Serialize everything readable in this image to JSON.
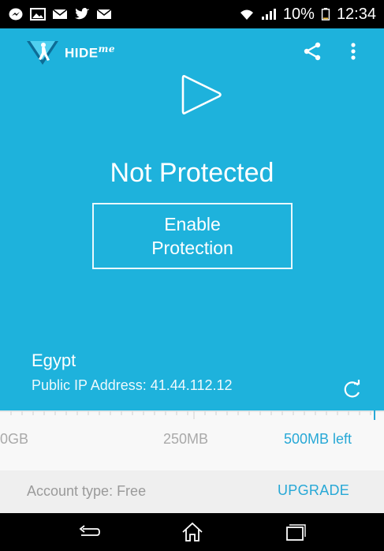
{
  "status_bar": {
    "battery": "10%",
    "time": "12:34",
    "notification_icons": [
      "messenger-icon",
      "image-icon",
      "mail-icon",
      "twitter-icon",
      "mail-icon"
    ]
  },
  "app": {
    "logo_text": "HIDE",
    "logo_suffix": "me",
    "share_icon": "share-icon",
    "menu_icon": "overflow-menu-icon"
  },
  "connection": {
    "status": "Not Protected",
    "button_label": "Enable Protection",
    "country": "Egypt",
    "ip_label": "Public IP Address: 41.44.112.12"
  },
  "usage": {
    "min_label": "0GB",
    "mid_label": "250MB",
    "remaining_label": "500MB left"
  },
  "account": {
    "type_label": "Account type: Free",
    "upgrade_label": "UPGRADE"
  },
  "colors": {
    "primary": "#1eb2dc",
    "accent": "#27a8d6",
    "muted_text": "#a9a9a9"
  }
}
